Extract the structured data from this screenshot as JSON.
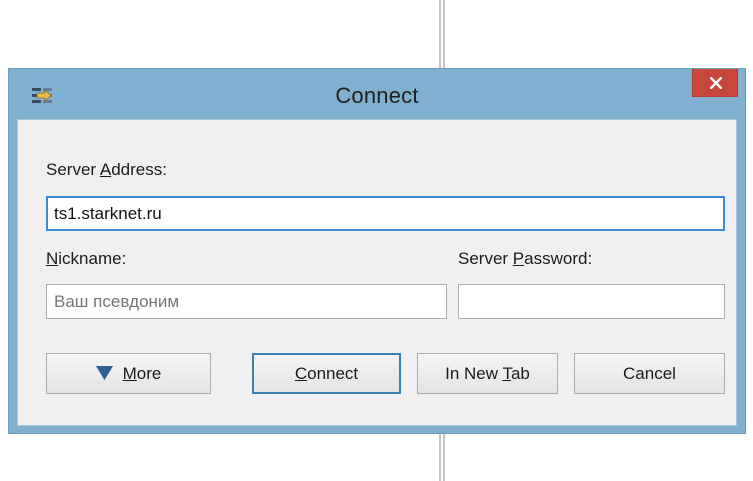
{
  "window": {
    "title": "Connect",
    "icon": "connect-arrows-icon",
    "close_icon": "close-icon",
    "close_color": "#c7473a",
    "titlebar_color": "#7fb0cf"
  },
  "form": {
    "server_address": {
      "label_prefix": "Server ",
      "label_mnemonic": "A",
      "label_suffix": "ddress:",
      "value": "ts1.starknet.ru"
    },
    "nickname": {
      "label_prefix": "",
      "label_mnemonic": "N",
      "label_suffix": "ickname:",
      "value": "Ваш псевдоним"
    },
    "server_password": {
      "label_prefix": "Server ",
      "label_mnemonic": "P",
      "label_suffix": "assword:",
      "value": ""
    }
  },
  "buttons": {
    "more": {
      "mnemonic": "M",
      "rest": "ore",
      "icon": "triangle-down-icon"
    },
    "connect": {
      "mnemonic": "C",
      "rest": "onnect"
    },
    "new_tab": {
      "prefix": "In New ",
      "mnemonic": "T",
      "rest": "ab"
    },
    "cancel": {
      "label": "Cancel"
    }
  }
}
